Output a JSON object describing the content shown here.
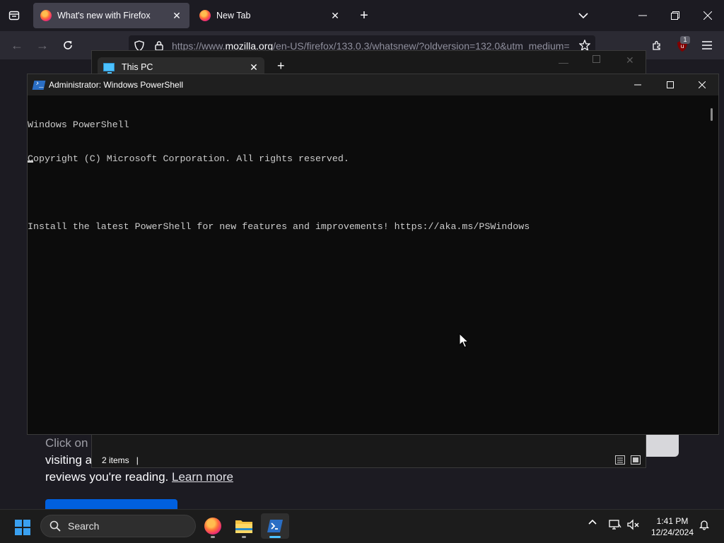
{
  "firefox": {
    "tabs": [
      {
        "label": "What's new with Firefox",
        "active": true
      },
      {
        "label": "New Tab",
        "active": false
      }
    ],
    "url": {
      "prefix": "https://www.",
      "domain": "mozilla.org",
      "rest": "/en-US/firefox/133.0.3/whatsnew/?oldversion=132.0&utm_medium="
    },
    "extension_badge": "1",
    "page": {
      "line1": "Click on",
      "line2": "visiting a",
      "line3_text": "reviews you're reading.",
      "line3_link": "Learn more"
    }
  },
  "explorer": {
    "tab_label": "This PC",
    "new_tab": "+",
    "status": "2 items"
  },
  "powershell": {
    "title": "Administrator: Windows PowerShell",
    "lines": [
      "Windows PowerShell",
      "Copyright (C) Microsoft Corporation. All rights reserved.",
      "",
      "Install the latest PowerShell for new features and improvements! https://aka.ms/PSWindows"
    ]
  },
  "taskbar": {
    "search_label": "Search",
    "time": "1:41 PM",
    "date": "12/24/2024"
  },
  "colors": {
    "firefox_bg": "#1c1b22",
    "console_bg": "#0c0c0c",
    "accent_blue": "#0060df",
    "windows_accent": "#4cc2ff"
  }
}
